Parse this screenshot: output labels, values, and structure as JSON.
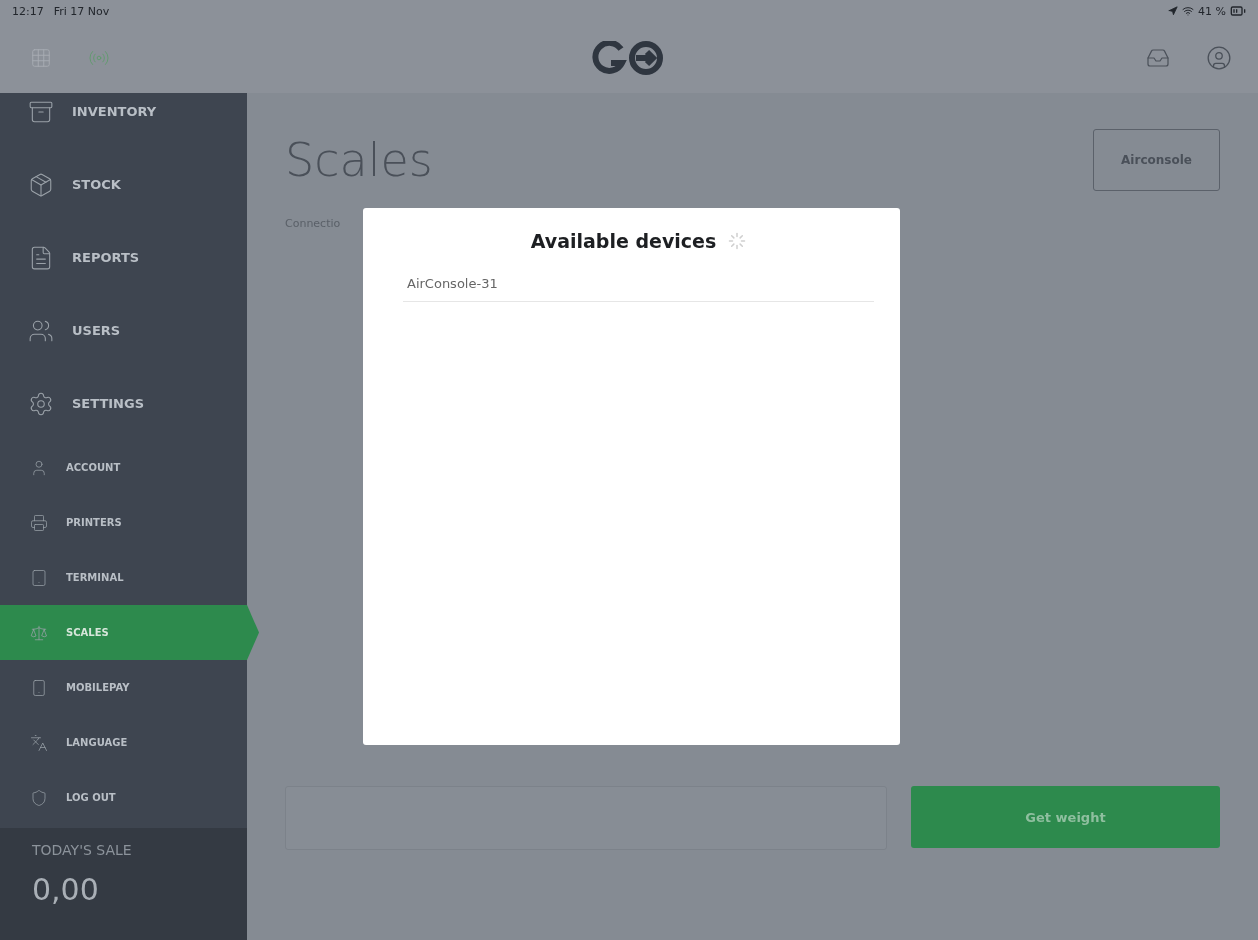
{
  "status_bar": {
    "time": "12:17",
    "date": "Fri 17 Nov",
    "battery": "41 %"
  },
  "sidebar": {
    "items": [
      {
        "label": "INVENTORY",
        "kind": "main",
        "selected": false
      },
      {
        "label": "STOCK",
        "kind": "main",
        "selected": false
      },
      {
        "label": "REPORTS",
        "kind": "main",
        "selected": false
      },
      {
        "label": "USERS",
        "kind": "main",
        "selected": false
      },
      {
        "label": "SETTINGS",
        "kind": "main",
        "selected": false
      },
      {
        "label": "ACCOUNT",
        "kind": "sub",
        "selected": false
      },
      {
        "label": "PRINTERS",
        "kind": "sub",
        "selected": false
      },
      {
        "label": "TERMINAL",
        "kind": "sub",
        "selected": false
      },
      {
        "label": "SCALES",
        "kind": "sub",
        "selected": true
      },
      {
        "label": "MOBILEPAY",
        "kind": "sub",
        "selected": false
      },
      {
        "label": "LANGUAGE",
        "kind": "sub",
        "selected": false
      },
      {
        "label": "LOG OUT",
        "kind": "sub",
        "selected": false
      }
    ],
    "todays_sale": {
      "label": "TODAY'S SALE",
      "amount": "0,00"
    }
  },
  "page": {
    "title": "Scales",
    "connection_label": "Connectio",
    "device_button": "Airconsole",
    "action_button": "Get weight"
  },
  "dialog": {
    "title": "Available devices",
    "devices": [
      {
        "name": "AirConsole-31"
      }
    ]
  }
}
